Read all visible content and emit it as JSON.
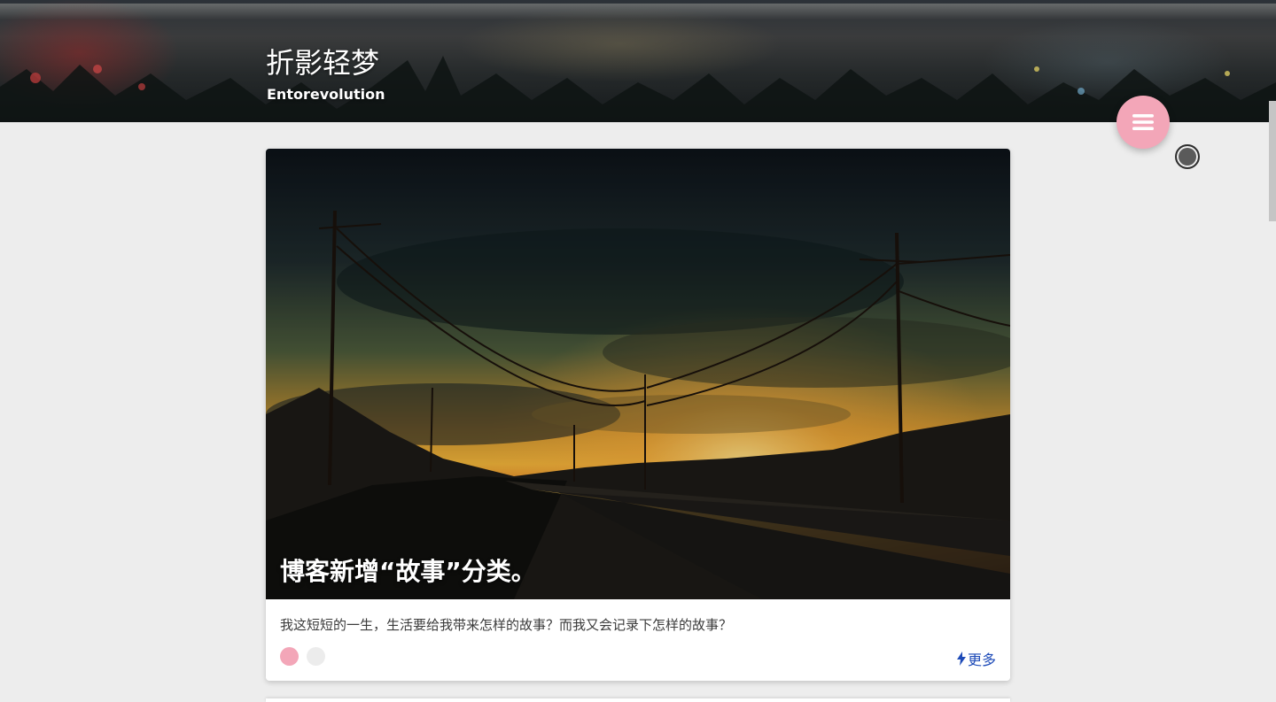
{
  "site": {
    "title": "折影轻梦",
    "subtitle": "Entorevolution"
  },
  "controls": {
    "menu_icon": "menu-icon",
    "theme_icon": "dark-mode-icon"
  },
  "post": {
    "title": "博客新增“故事”分类。",
    "excerpt": "我这短短的一生，生活要给我带来怎样的故事？而我又会记录下怎样的故事？",
    "more_label": "更多",
    "more_icon": "bolt-icon"
  },
  "colors": {
    "accent": "#f3a6b8",
    "link": "#1e4bb8",
    "page_bg": "#ededed"
  }
}
